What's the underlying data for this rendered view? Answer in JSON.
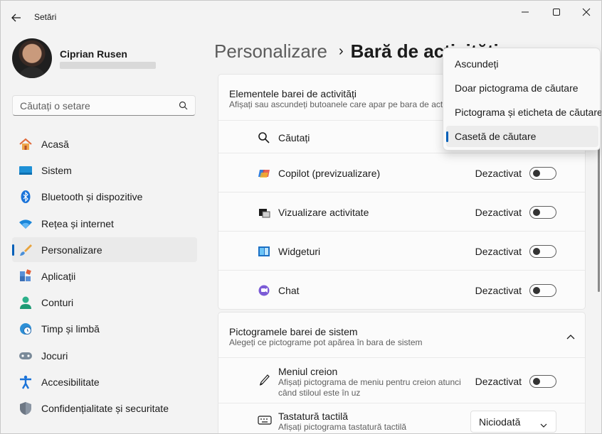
{
  "window": {
    "title": "Setări"
  },
  "user": {
    "name": "Ciprian Rusen"
  },
  "search": {
    "placeholder": "Căutați o setare"
  },
  "sidebar": {
    "items": [
      {
        "label": "Acasă",
        "icon": "home-icon"
      },
      {
        "label": "Sistem",
        "icon": "system-icon"
      },
      {
        "label": "Bluetooth și dispozitive",
        "icon": "bluetooth-icon"
      },
      {
        "label": "Rețea și internet",
        "icon": "wifi-icon"
      },
      {
        "label": "Personalizare",
        "icon": "brush-icon",
        "active": true
      },
      {
        "label": "Aplicații",
        "icon": "apps-icon"
      },
      {
        "label": "Conturi",
        "icon": "account-icon"
      },
      {
        "label": "Timp și limbă",
        "icon": "globe-clock-icon"
      },
      {
        "label": "Jocuri",
        "icon": "gamepad-icon"
      },
      {
        "label": "Accesibilitate",
        "icon": "accessibility-icon"
      },
      {
        "label": "Confidențialitate și securitate",
        "icon": "shield-icon"
      }
    ]
  },
  "breadcrumb": {
    "parent": "Personalizare",
    "separator": "›",
    "current": "Bară de activități"
  },
  "taskbar_items": {
    "title": "Elementele barei de activități",
    "subtitle": "Afișați sau ascundeți butoanele care apar pe bara de activități",
    "rows": [
      {
        "label": "Căutați",
        "icon": "search-icon"
      },
      {
        "label": "Copilot (previzualizare)",
        "icon": "copilot-icon",
        "state": "Dezactivat",
        "on": false
      },
      {
        "label": "Vizualizare activitate",
        "icon": "task-view-icon",
        "state": "Dezactivat",
        "on": false
      },
      {
        "label": "Widgeturi",
        "icon": "widgets-icon",
        "state": "Dezactivat",
        "on": false
      },
      {
        "label": "Chat",
        "icon": "chat-icon",
        "state": "Dezactivat",
        "on": false
      }
    ]
  },
  "system_tray": {
    "title": "Pictogramele barei de sistem",
    "subtitle": "Alegeți ce pictograme pot apărea în bara de sistem",
    "rows": [
      {
        "label": "Meniul creion",
        "desc": "Afișați pictograma de meniu pentru creion atunci când stiloul este în uz",
        "state": "Dezactivat",
        "on": false,
        "icon": "pen-icon"
      },
      {
        "label": "Tastatură tactilă",
        "desc": "Afișați pictograma tastatură tactilă",
        "select_value": "Niciodată",
        "icon": "keyboard-icon"
      }
    ]
  },
  "search_dropdown": {
    "options": [
      "Ascundeți",
      "Doar pictograma de căutare",
      "Pictograma și eticheta de căutare",
      "Casetă de căutare"
    ],
    "selected": "Casetă de căutare"
  },
  "colors": {
    "accent": "#005fb8",
    "background": "#f3f3f3",
    "card": "#fbfbfb"
  }
}
